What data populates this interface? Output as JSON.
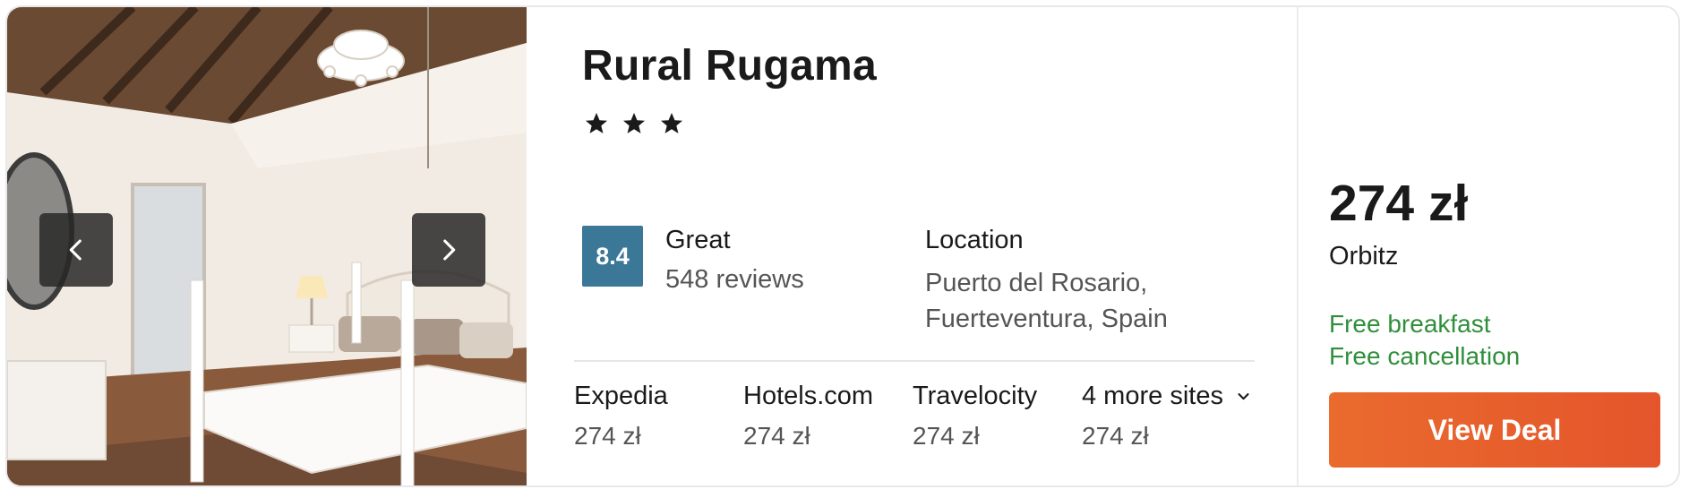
{
  "hotel": {
    "name": "Rural Rugama",
    "star_count": 3,
    "stars_display": "★ ★ ★"
  },
  "rating": {
    "score": "8.4",
    "label": "Great",
    "reviews": "548 reviews",
    "badge_color": "#3b7897"
  },
  "location": {
    "label": "Location",
    "line1": "Puerto del Rosario,",
    "line2": "Fuerteventura, Spain"
  },
  "sites": [
    {
      "name": "Expedia",
      "price": "274 zł"
    },
    {
      "name": "Hotels.com",
      "price": "274 zł"
    },
    {
      "name": "Travelocity",
      "price": "274 zł"
    },
    {
      "name": "4 more sites",
      "price": "274 zł"
    }
  ],
  "deal": {
    "price": "274 zł",
    "provider": "Orbitz",
    "perks": [
      "Free breakfast",
      "Free cancellation"
    ],
    "button_label": "View Deal",
    "perk_color": "#2f8f3b",
    "button_color": "#e85f2c"
  },
  "icons": {
    "prev": "chevron-left-icon",
    "next": "chevron-right-icon",
    "expand": "chevron-down-icon",
    "star": "star-icon"
  }
}
